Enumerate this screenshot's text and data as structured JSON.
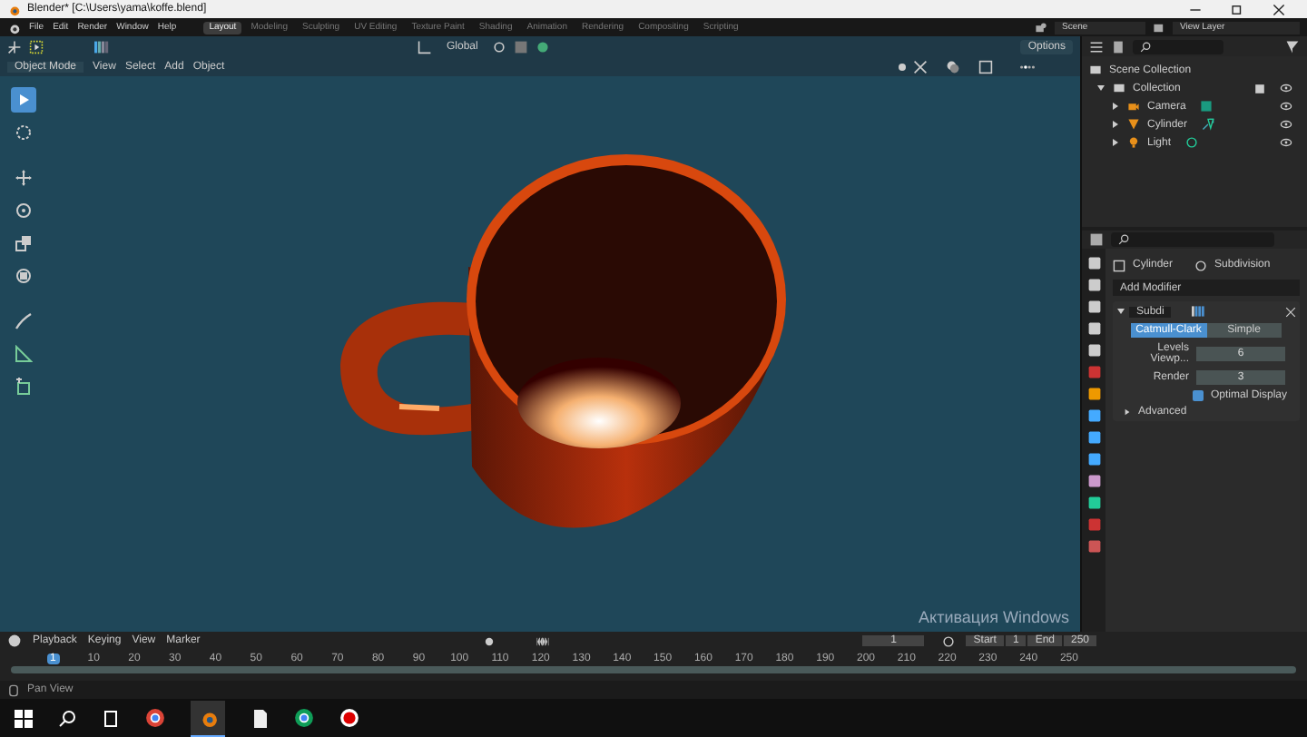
{
  "window": {
    "title": "Blender* [C:\\Users\\yama\\koffe.blend]"
  },
  "menu": [
    "File",
    "Edit",
    "Render",
    "Window",
    "Help"
  ],
  "workspaces": [
    {
      "label": "Layout",
      "selected": true
    },
    {
      "label": "Modeling",
      "selected": false
    },
    {
      "label": "Sculpting",
      "selected": false
    },
    {
      "label": "UV Editing",
      "selected": false
    },
    {
      "label": "Texture Paint",
      "selected": false
    },
    {
      "label": "Shading",
      "selected": false
    },
    {
      "label": "Animation",
      "selected": false
    },
    {
      "label": "Rendering",
      "selected": false
    },
    {
      "label": "Compositing",
      "selected": false
    },
    {
      "label": "Scripting",
      "selected": false
    }
  ],
  "scene": "Scene",
  "view_layer": "View Layer",
  "viewport": {
    "mode": "Object Mode",
    "menu": [
      "View",
      "Select",
      "Add",
      "Object"
    ],
    "transform": "Global",
    "options": "Options"
  },
  "tools": [
    {
      "kind": "select",
      "selected": true
    },
    {
      "kind": "cursor",
      "selected": false
    },
    {
      "kind": "move",
      "selected": false
    },
    {
      "kind": "rotate",
      "selected": false
    },
    {
      "kind": "scale",
      "selected": false
    },
    {
      "kind": "transform",
      "selected": false
    },
    {
      "kind": "annotate",
      "selected": false
    },
    {
      "kind": "measure",
      "selected": false
    },
    {
      "kind": "add-cube",
      "selected": false
    }
  ],
  "outliner": {
    "root": "Scene Collection",
    "items": [
      {
        "label": "Collection",
        "expanded": true,
        "children": [
          {
            "label": "Camera",
            "expanded": false
          },
          {
            "label": "Cylinder",
            "expanded": false
          },
          {
            "label": "Light",
            "expanded": false
          }
        ]
      }
    ]
  },
  "properties": {
    "object": "Cylinder",
    "modifier_tab": "Subdivision",
    "add_modifier": "Add Modifier",
    "modifier": {
      "name": "Subdi",
      "modes": [
        {
          "label": "Catmull-Clark",
          "selected": true
        },
        {
          "label": "Simple",
          "selected": false
        }
      ],
      "fields": [
        {
          "label": "Levels Viewp...",
          "value": "6"
        },
        {
          "label": "Render",
          "value": "3"
        }
      ],
      "optimal_display": {
        "label": "Optimal Display",
        "checked": true
      },
      "advanced": "Advanced"
    }
  },
  "timeline": {
    "menu": [
      "Playback",
      "Keying",
      "View",
      "Marker"
    ],
    "current_frame": "1",
    "start_label": "Start",
    "start": "1",
    "end_label": "End",
    "end": "250",
    "ticks": [
      {
        "label": "1",
        "selected": true
      },
      {
        "label": "10",
        "selected": false
      },
      {
        "label": "20",
        "selected": false
      },
      {
        "label": "30",
        "selected": false
      },
      {
        "label": "40",
        "selected": false
      },
      {
        "label": "50",
        "selected": false
      },
      {
        "label": "60",
        "selected": false
      },
      {
        "label": "70",
        "selected": false
      },
      {
        "label": "80",
        "selected": false
      },
      {
        "label": "90",
        "selected": false
      },
      {
        "label": "100",
        "selected": false
      },
      {
        "label": "110",
        "selected": false
      },
      {
        "label": "120",
        "selected": false
      },
      {
        "label": "130",
        "selected": false
      },
      {
        "label": "140",
        "selected": false
      },
      {
        "label": "150",
        "selected": false
      },
      {
        "label": "160",
        "selected": false
      },
      {
        "label": "170",
        "selected": false
      },
      {
        "label": "180",
        "selected": false
      },
      {
        "label": "190",
        "selected": false
      },
      {
        "label": "200",
        "selected": false
      },
      {
        "label": "210",
        "selected": false
      },
      {
        "label": "220",
        "selected": false
      },
      {
        "label": "230",
        "selected": false
      },
      {
        "label": "240",
        "selected": false
      },
      {
        "label": "250",
        "selected": false
      }
    ]
  },
  "status_bar": {
    "text": "Pan View"
  },
  "windows_notice": "Активация Windows"
}
